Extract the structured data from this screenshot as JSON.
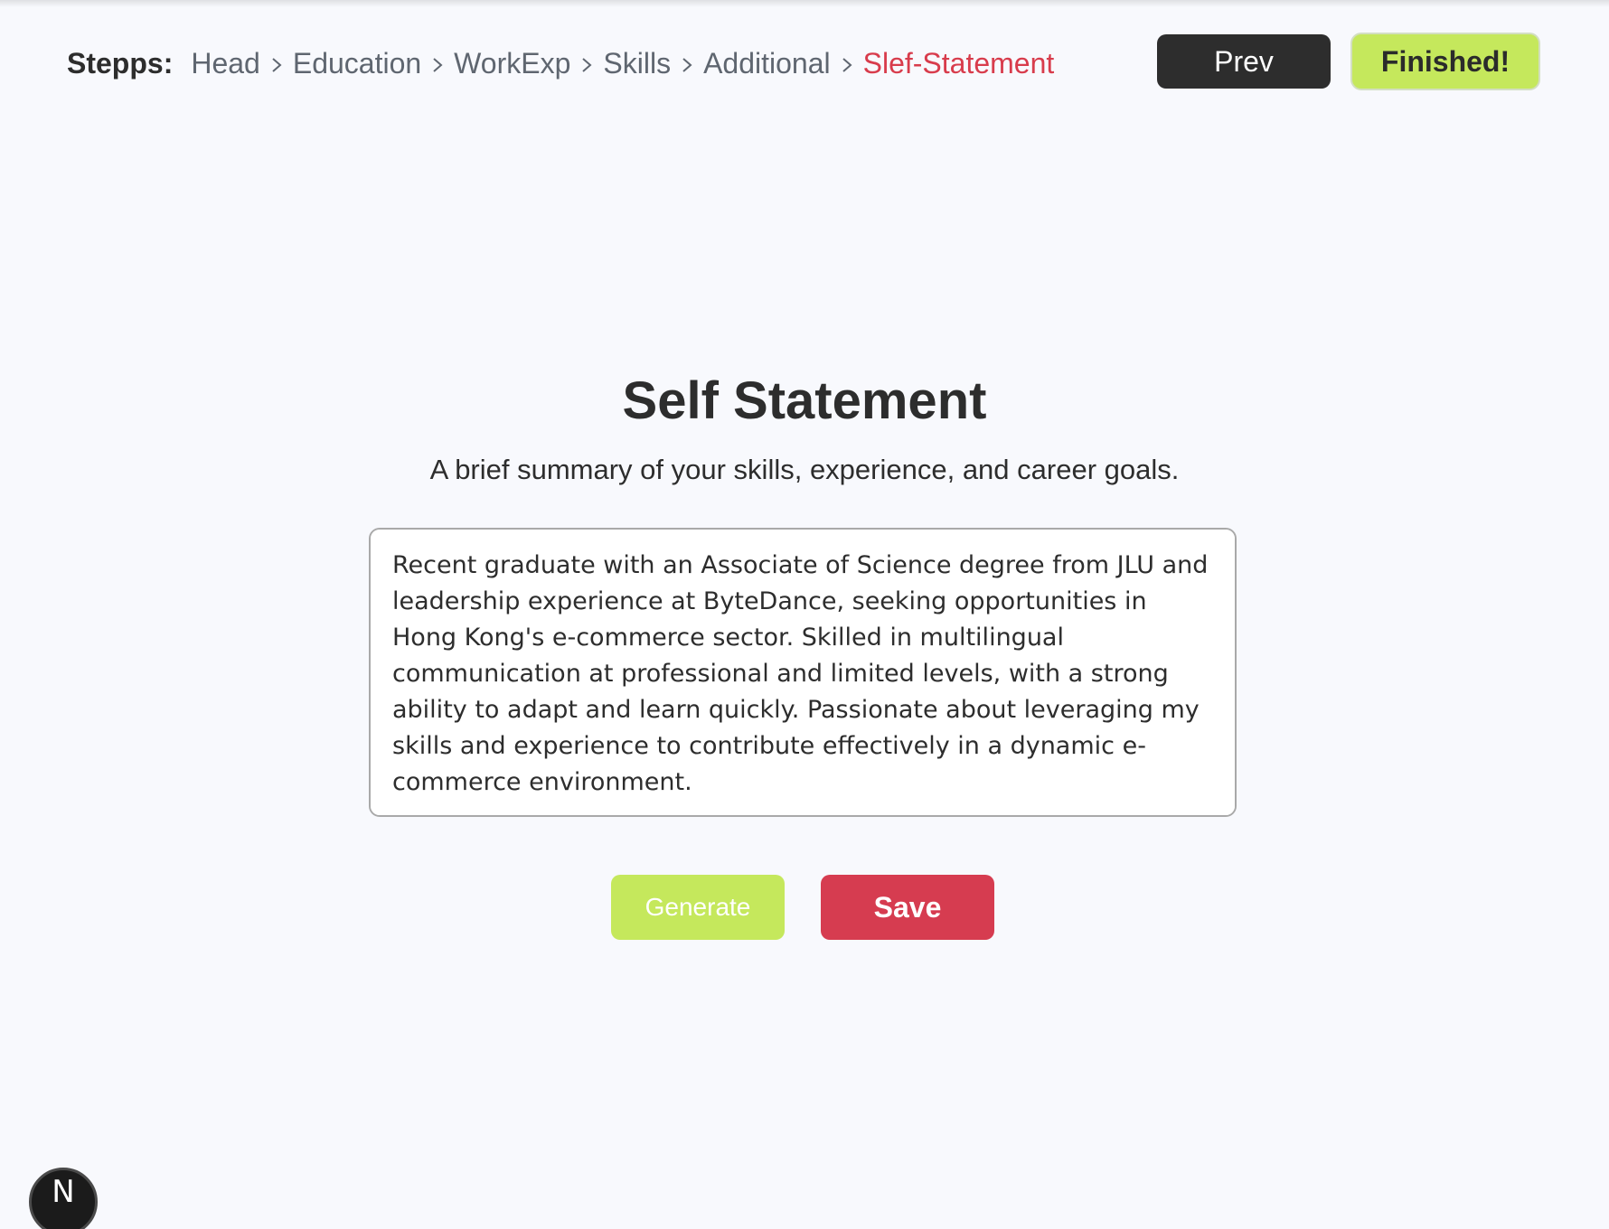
{
  "header": {
    "steps_label": "Stepps:",
    "steps": [
      {
        "label": "Head"
      },
      {
        "label": "Education"
      },
      {
        "label": "WorkExp"
      },
      {
        "label": "Skills"
      },
      {
        "label": "Additional"
      },
      {
        "label": "Slef-Statement",
        "active": true
      }
    ],
    "prev_label": "Prev",
    "finished_label": "Finished!"
  },
  "main": {
    "title": "Self Statement",
    "subtitle": "A brief summary of your skills, experience, and career goals.",
    "statement_value": "Recent graduate with an Associate of Science degree from JLU and leadership experience at ByteDance, seeking opportunities in Hong Kong's e-commerce sector. Skilled in multilingual communication at professional and limited levels, with a strong ability to adapt and learn quickly. Passionate about leveraging my skills and experience to contribute effectively in a dynamic e-commerce environment.",
    "generate_label": "Generate",
    "save_label": "Save"
  },
  "badge": {
    "letter": "N",
    "icon": "nextjs-logo-icon"
  },
  "colors": {
    "accent_green": "#c5e85c",
    "accent_red": "#d63c50",
    "dark": "#2d2d2d",
    "step_gray": "#5f6670",
    "background": "#f8f9fd"
  }
}
